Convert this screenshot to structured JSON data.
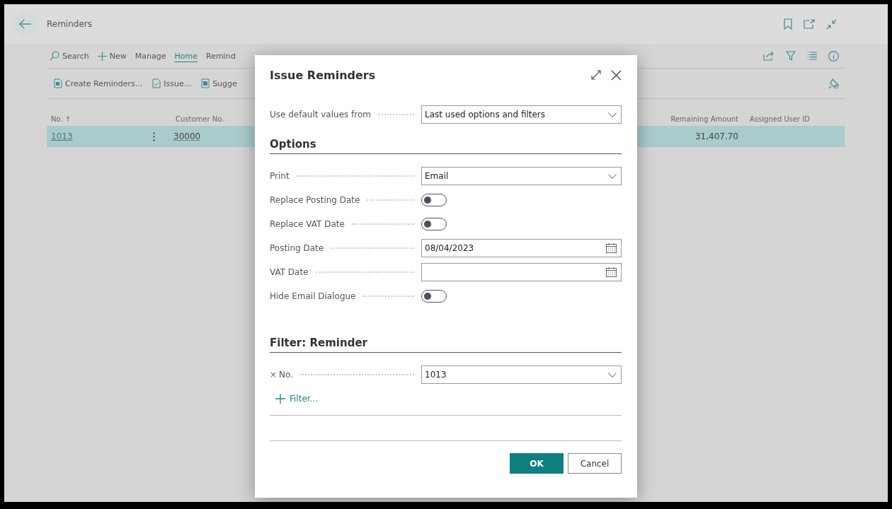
{
  "page": {
    "title": "Reminders",
    "actions": [
      {
        "label": "Search",
        "selected": false
      },
      {
        "label": "New",
        "selected": false
      },
      {
        "label": "Manage",
        "selected": false
      },
      {
        "label": "Home",
        "selected": true
      },
      {
        "label": "Remind",
        "selected": false
      }
    ],
    "subactions": [
      {
        "label": "Create Reminders..."
      },
      {
        "label": "Issue..."
      },
      {
        "label": "Sugge"
      }
    ],
    "columns_left": [
      {
        "label": "No. ↑"
      },
      {
        "label": "Customer No."
      }
    ],
    "columns_right": [
      {
        "label": "Remaining Amount"
      },
      {
        "label": "Assigned User ID"
      }
    ],
    "row": {
      "selected": true,
      "no": "1013",
      "customer_no": "30000",
      "remaining_amount": "31,407.70"
    }
  },
  "dialog": {
    "title": "Issue Reminders",
    "defaults": {
      "label": "Use default values from",
      "value": "Last used options and filters"
    },
    "options_heading": "Options",
    "options": [
      {
        "kind": "select",
        "label": "Print",
        "value": "Email"
      },
      {
        "kind": "toggle",
        "label": "Replace Posting Date",
        "on": false
      },
      {
        "kind": "toggle",
        "label": "Replace VAT Date",
        "on": false
      },
      {
        "kind": "date",
        "label": "Posting Date",
        "value": "08/04/2023"
      },
      {
        "kind": "date",
        "label": "VAT Date"
      },
      {
        "kind": "toggle",
        "label": "Hide Email Dialogue",
        "on": false
      }
    ],
    "filter_heading": "Filter: Reminder",
    "filters": [
      {
        "clear": "×",
        "label": "No.",
        "value": "1013"
      }
    ],
    "add_filter": "Filter...",
    "buttons": [
      {
        "label": "OK",
        "kind": "primary"
      },
      {
        "label": "Cancel",
        "kind": "secondary"
      }
    ]
  }
}
